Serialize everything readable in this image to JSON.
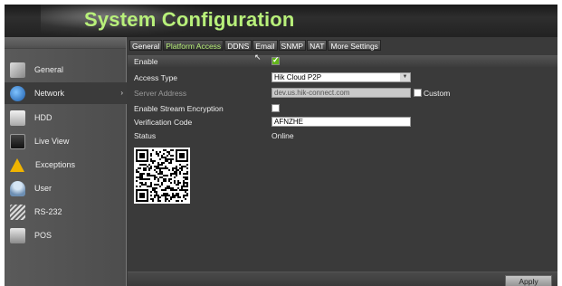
{
  "window": {
    "title": "System Configuration"
  },
  "sidebar": {
    "items": [
      {
        "label": "General",
        "icon": "gear-icon",
        "active": false
      },
      {
        "label": "Network",
        "icon": "network-globe-icon",
        "active": true
      },
      {
        "label": "HDD",
        "icon": "hdd-icon",
        "active": false
      },
      {
        "label": "Live View",
        "icon": "monitor-icon",
        "active": false
      },
      {
        "label": "Exceptions",
        "icon": "warning-icon",
        "active": false
      },
      {
        "label": "User",
        "icon": "user-icon",
        "active": false
      },
      {
        "label": "RS-232",
        "icon": "serial-port-icon",
        "active": false
      },
      {
        "label": "POS",
        "icon": "pos-terminal-icon",
        "active": false
      }
    ],
    "active_arrow": "›"
  },
  "tabs": [
    {
      "label": "General",
      "active": false
    },
    {
      "label": "Platform Access",
      "active": true
    },
    {
      "label": "DDNS",
      "active": false
    },
    {
      "label": "Email",
      "active": false
    },
    {
      "label": "SNMP",
      "active": false
    },
    {
      "label": "NAT",
      "active": false
    },
    {
      "label": "More Settings",
      "active": false
    }
  ],
  "form": {
    "enable_label": "Enable",
    "enable_checked": true,
    "access_type_label": "Access Type",
    "access_type_value": "Hik Cloud P2P",
    "server_address_label": "Server Address",
    "server_address_value": "dev.us.hik-connect.com",
    "custom_label": "Custom",
    "custom_checked": false,
    "stream_encryption_label": "Enable Stream Encryption",
    "stream_encryption_checked": false,
    "verification_code_label": "Verification Code",
    "verification_code_value": "AFNZHE",
    "status_label": "Status",
    "status_value": "Online"
  },
  "qr_code": {
    "icon": "qr-code-icon"
  },
  "footer": {
    "apply_label": "Apply"
  },
  "colors": {
    "title_green": "#b8f07a",
    "active_tab_green": "#b8f07a",
    "checkbox_green": "#62b51a",
    "panel_dark": "#3a3a3a"
  }
}
